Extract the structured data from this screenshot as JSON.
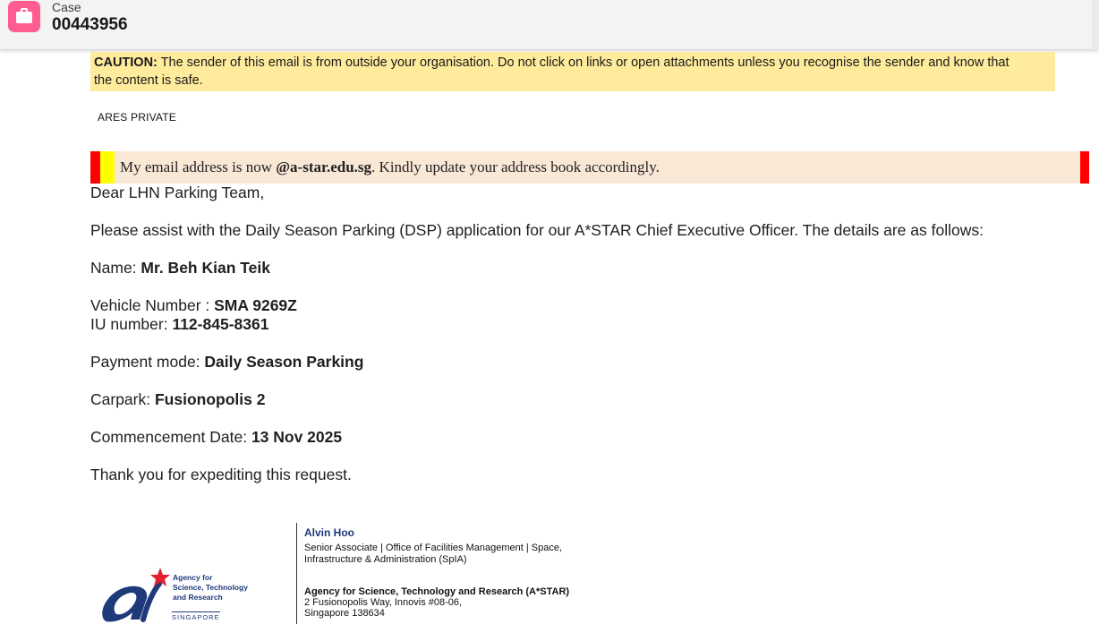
{
  "header": {
    "icon": "briefcase-icon",
    "type_label": "Case",
    "case_number": "00443956"
  },
  "caution": {
    "label": "CAUTION:",
    "text_line1": " The sender of this email is from outside your organisation. Do not click on links or open attachments unless you recognise the sender and know that",
    "text_line2": "the content is safe."
  },
  "classification": "ARES PRIVATE",
  "notice": {
    "prefix": "My email address is now ",
    "domain": "@a-star.edu.sg",
    "suffix": ". Kindly update your address book accordingly."
  },
  "email": {
    "greeting": "Dear LHN Parking Team,",
    "intro": "Please assist with the Daily Season Parking (DSP) application for our A*STAR Chief Executive Officer. The details are as follows:",
    "name_label": "Name: ",
    "name_value": "Mr. Beh Kian Teik",
    "vehicle_label": "Vehicle Number : ",
    "vehicle_value": "SMA 9269Z",
    "iu_label": "IU number: ",
    "iu_value": "112-845-8361",
    "payment_label": "Payment mode: ",
    "payment_value": "Daily Season Parking",
    "carpark_label": "Carpark: ",
    "carpark_value": "Fusionopolis 2",
    "date_label": "Commencement Date: ",
    "date_value": "13 Nov 2025",
    "closing": "Thank you for expediting this request."
  },
  "signature": {
    "name": "Alvin Hoo",
    "title_line1": "Senior Associate | Office of Facilities Management | Space,",
    "title_line2": "Infrastructure & Administration (SpIA)",
    "org": "Agency for Science, Technology and Research (A*STAR)",
    "address1": "2 Fusionopolis Way, Innovis #08-06,",
    "address2": "Singapore 138634"
  },
  "logo": {
    "line1": "Agency for",
    "line2": "Science, Technology",
    "line3": "and Research",
    "country": "SINGAPORE",
    "colors": {
      "blue": "#1e3a7b",
      "red": "#e5202e"
    }
  },
  "colors": {
    "case_icon_bg": "#ff5d8f",
    "caution_bg": "#ffeb9c",
    "notice_bg": "#fae8d7",
    "notice_red": "#ff0000",
    "notice_yellow": "#ffff00"
  }
}
